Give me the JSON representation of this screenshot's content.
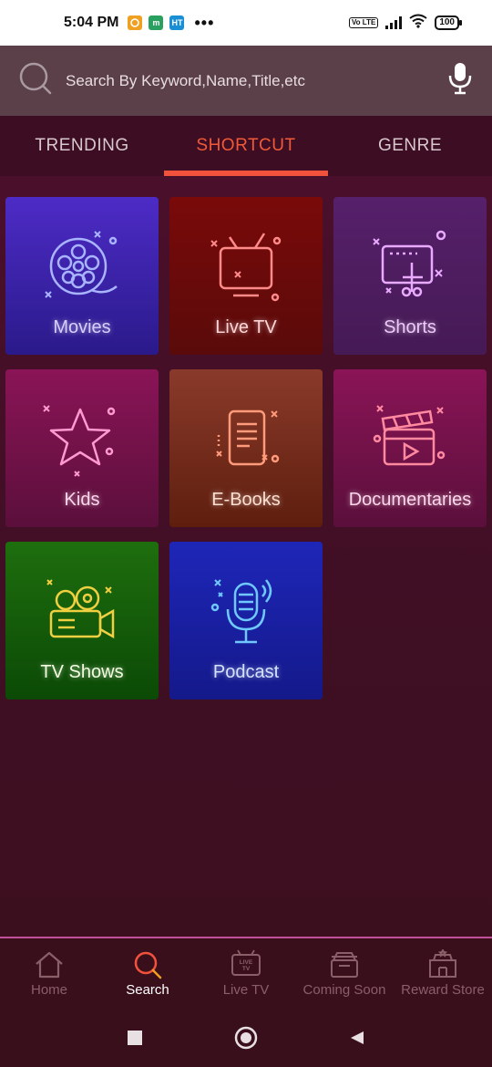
{
  "status_bar": {
    "time": "5:04 PM",
    "notification_icons": [
      {
        "name": "app-notification-icon",
        "color": "#f0a020"
      },
      {
        "name": "mail-notification-icon",
        "color": "#2aa060",
        "glyph": "m"
      },
      {
        "name": "news-notification-icon",
        "color": "#1a8fd6",
        "glyph": "HT"
      }
    ],
    "more": "•••",
    "network": "Vo LTE",
    "battery": "100"
  },
  "search": {
    "placeholder": "Search By Keyword,Name,Title,etc"
  },
  "tabs": [
    {
      "label": "TRENDING",
      "active": false
    },
    {
      "label": "SHORTCUT",
      "active": true
    },
    {
      "label": "GENRE",
      "active": false
    }
  ],
  "shortcuts": [
    {
      "label": "Movies",
      "icon": "film-reel-icon"
    },
    {
      "label": "Live TV",
      "icon": "tv-icon"
    },
    {
      "label": "Shorts",
      "icon": "video-edit-icon"
    },
    {
      "label": "Kids",
      "icon": "star-icon"
    },
    {
      "label": "E-Books",
      "icon": "ebook-reader-icon"
    },
    {
      "label": "Documentaries",
      "icon": "clapperboard-icon"
    },
    {
      "label": "TV Shows",
      "icon": "video-camera-icon"
    },
    {
      "label": "Podcast",
      "icon": "microphone-icon"
    }
  ],
  "bottom_nav": [
    {
      "label": "Home",
      "icon": "home-icon",
      "active": false
    },
    {
      "label": "Search",
      "icon": "search-icon",
      "active": true
    },
    {
      "label": "Live TV",
      "icon": "live-tv-icon",
      "active": false,
      "icon_text": "LIVE TV"
    },
    {
      "label": "Coming Soon",
      "icon": "coming-soon-icon",
      "active": false
    },
    {
      "label": "Reward Store",
      "icon": "reward-store-icon",
      "active": false
    }
  ],
  "colors": {
    "accent": "#f0523c",
    "background": "#4a0f2a"
  }
}
